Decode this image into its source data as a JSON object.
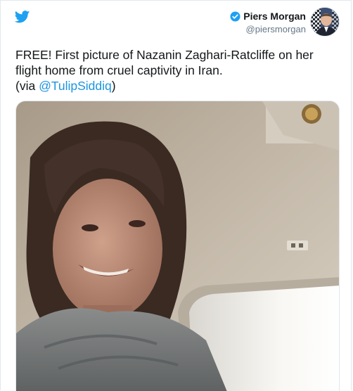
{
  "tweet": {
    "author_name": "Piers Morgan",
    "author_handle": "@piersmorgan",
    "text_main": "FREE! First picture of Nazanin Zaghari-Ratcliffe on her flight home from cruel captivity in Iran.",
    "text_via_prefix": "(via ",
    "text_mention": "@TulipSiddiq",
    "text_via_suffix": ")"
  },
  "icons": {
    "logo": "twitter-bird-icon",
    "verified": "verified-badge-icon"
  },
  "colors": {
    "brand": "#1da1f2",
    "link": "#1b95e0",
    "text": "#14171a",
    "secondary": "#657786"
  }
}
